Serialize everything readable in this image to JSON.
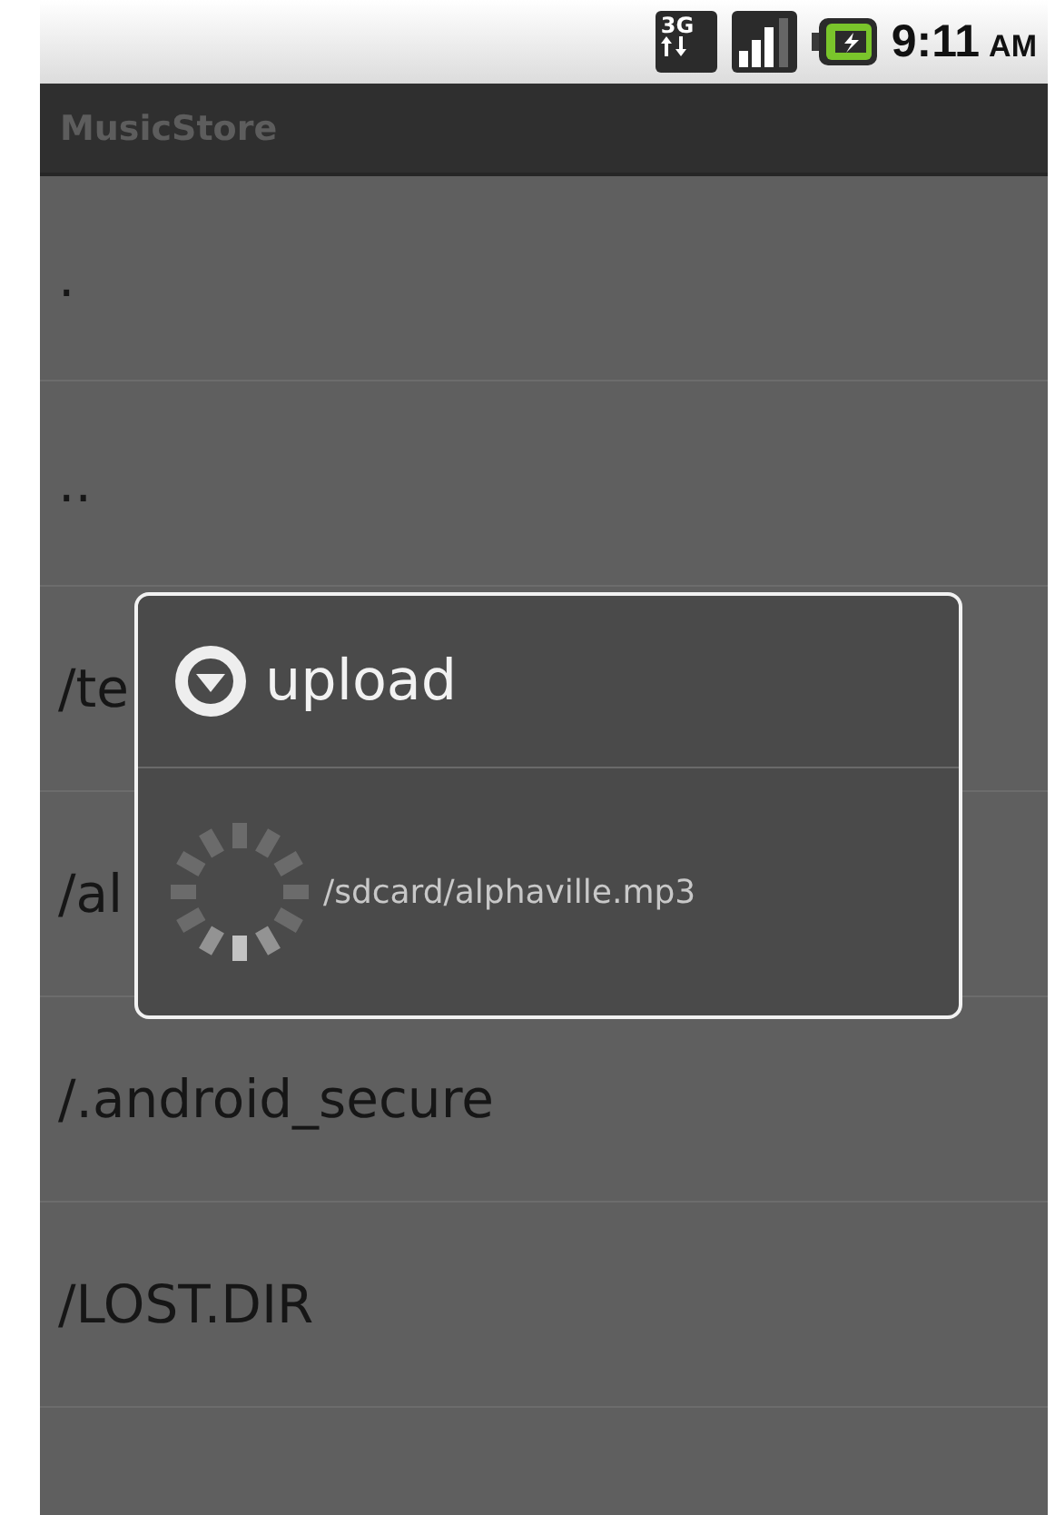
{
  "status_bar": {
    "network": "3G",
    "time": "9:11",
    "meridiem": "AM"
  },
  "app_bar": {
    "title": "MusicStore"
  },
  "list": {
    "items": [
      {
        "label": "."
      },
      {
        "label": ".."
      },
      {
        "label": "/te"
      },
      {
        "label": "/al"
      },
      {
        "label": "/.android_secure"
      },
      {
        "label": "/LOST.DIR"
      }
    ]
  },
  "dialog": {
    "title": "upload",
    "message": "/sdcard/alphaville.mp3"
  }
}
